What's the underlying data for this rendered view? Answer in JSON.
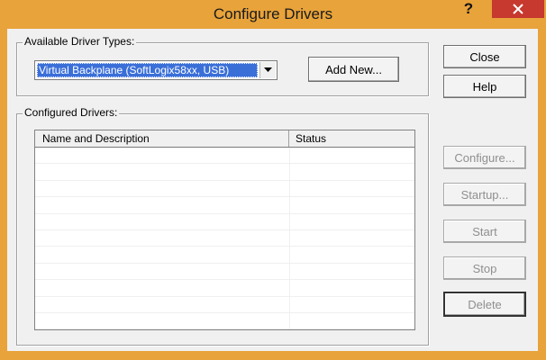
{
  "window": {
    "title": "Configure Drivers",
    "help_glyph": "?"
  },
  "available": {
    "group_label": "Available Driver Types:",
    "selected_driver": "Virtual Backplane (SoftLogix58xx, USB)",
    "add_new_label": "Add New..."
  },
  "configured": {
    "group_label": "Configured Drivers:",
    "columns": [
      "Name and Description",
      "Status"
    ],
    "rows": [
      "",
      "",
      "",
      "",
      "",
      "",
      "",
      "",
      "",
      "",
      ""
    ]
  },
  "buttons": {
    "close": "Close",
    "help": "Help",
    "configure": "Configure...",
    "startup": "Startup...",
    "start": "Start",
    "stop": "Stop",
    "delete": "Delete"
  },
  "colors": {
    "titlebar": "#e8a33a",
    "close_button": "#c7382e",
    "selection": "#3a6fd8"
  }
}
